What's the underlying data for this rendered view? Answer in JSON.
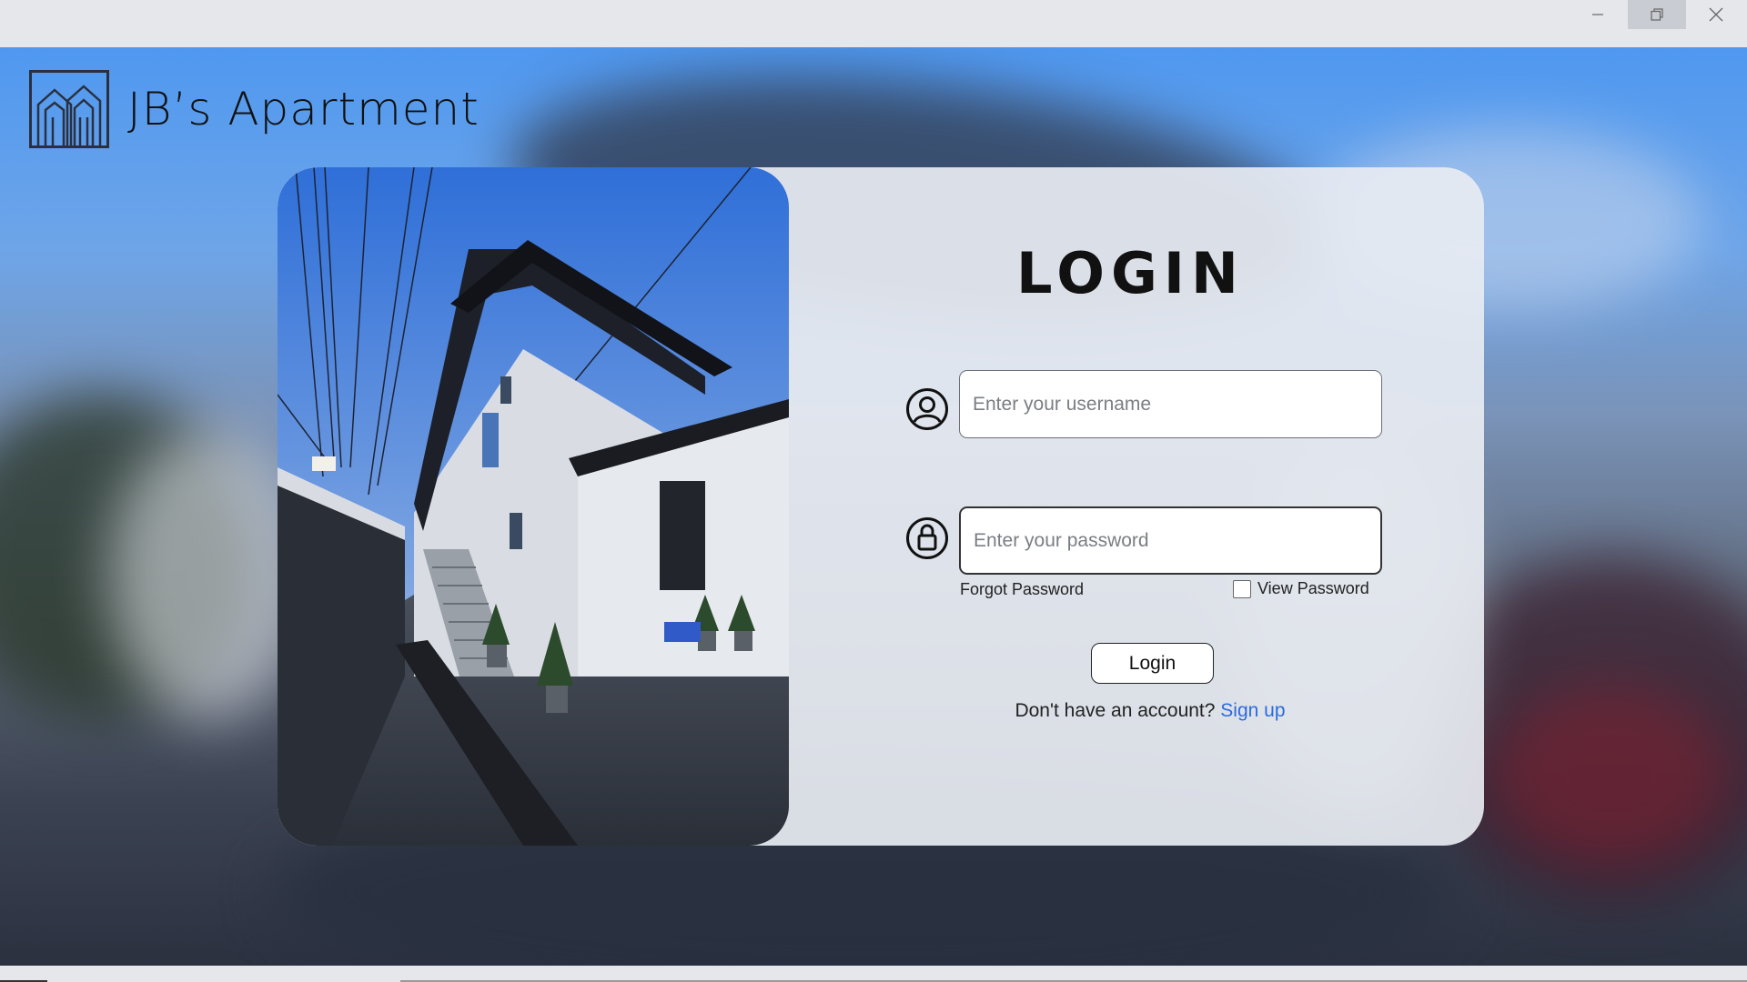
{
  "window": {
    "minimize_icon": "minimize-icon",
    "maximize_icon": "restore-icon",
    "close_icon": "close-icon"
  },
  "brand": {
    "name": "JB’s Apartment",
    "logo_icon": "apartment-logo-icon"
  },
  "login": {
    "title": "LOGIN",
    "username_placeholder": "Enter your username",
    "password_placeholder": "Enter your password",
    "forgot_password": "Forgot Password",
    "view_password": "View Password",
    "login_button": "Login",
    "no_account_text": "Don't have an account?",
    "sign_up_link": "Sign up",
    "user_icon": "user-icon",
    "lock_icon": "lock-icon"
  },
  "colors": {
    "link": "#2a6be0",
    "card": "#e8ecf2",
    "sky": "#4f98f0"
  }
}
